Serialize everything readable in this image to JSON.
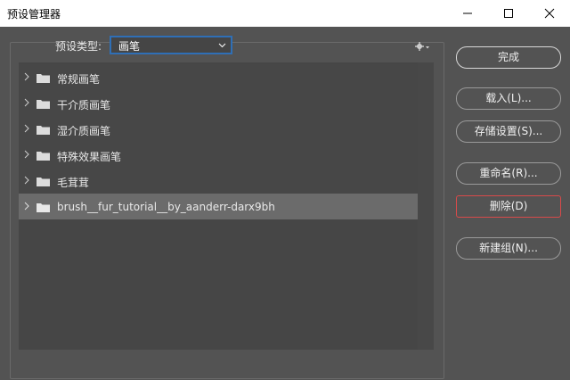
{
  "window": {
    "title": "预设管理器"
  },
  "toolbar": {
    "preset_type_label": "预设类型:",
    "preset_type_value": "画笔"
  },
  "list": {
    "items": [
      {
        "label": "常规画笔",
        "selected": false
      },
      {
        "label": "干介质画笔",
        "selected": false
      },
      {
        "label": "湿介质画笔",
        "selected": false
      },
      {
        "label": "特殊效果画笔",
        "selected": false
      },
      {
        "label": "毛茸茸",
        "selected": false
      },
      {
        "label": "brush__fur_tutorial__by_aanderr-darx9bh",
        "selected": true
      }
    ]
  },
  "buttons": {
    "done": "完成",
    "load": "载入(L)...",
    "save_set": "存储设置(S)...",
    "rename": "重命名(R)...",
    "delete": "删除(D)",
    "new_group": "新建组(N)..."
  },
  "icons": {
    "minimize": "minimize-icon",
    "maximize": "maximize-icon",
    "close": "close-icon",
    "gear": "gear-icon",
    "folder": "folder-icon",
    "chevron": "chevron-right-icon"
  },
  "colors": {
    "panel_bg": "#535353",
    "select_border": "#2f6fb6",
    "focus_border": "#d84a4a",
    "selected_row": "#6b6b6b"
  }
}
